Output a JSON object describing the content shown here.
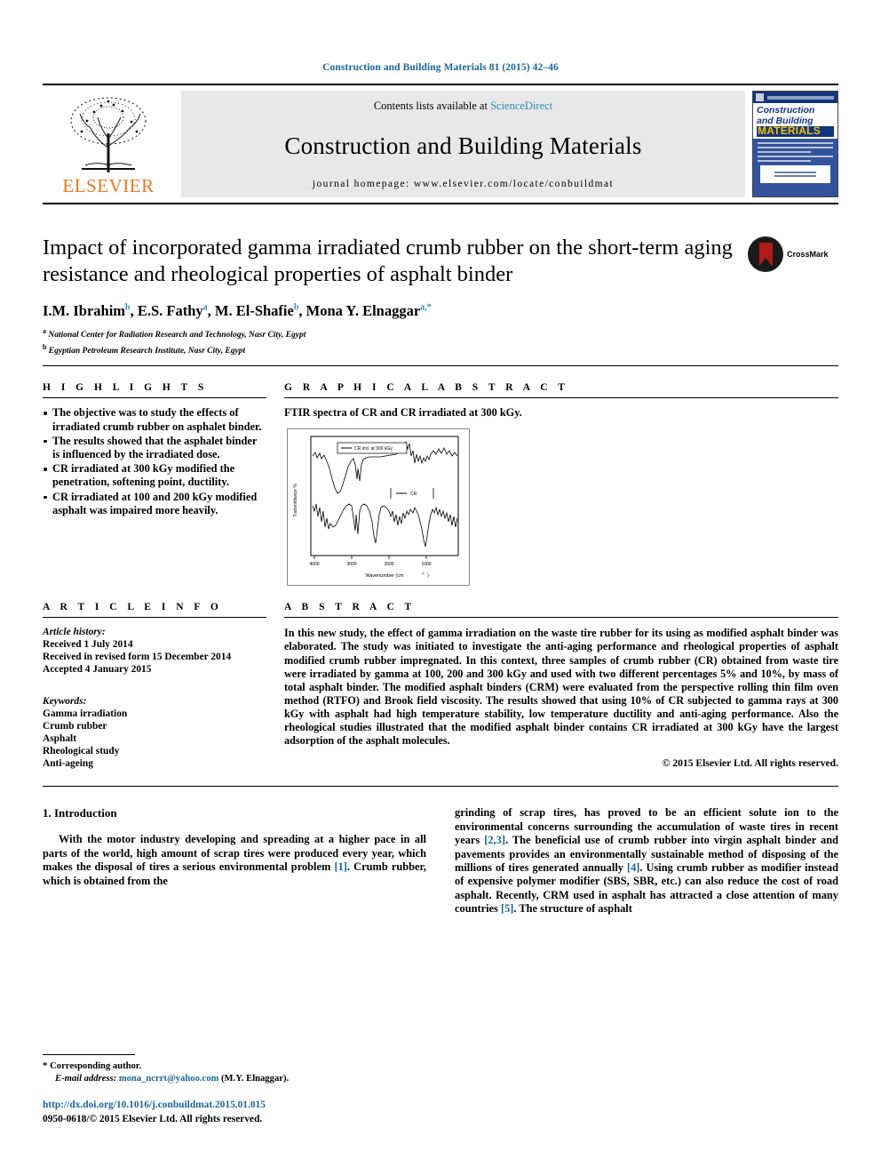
{
  "running_head": "Construction and Building Materials 81 (2015) 42–46",
  "masthead": {
    "publisher": "ELSEVIER",
    "contents_prefix": "Contents lists available at ",
    "contents_link": "ScienceDirect",
    "journal_name": "Construction and Building Materials",
    "homepage": "journal homepage: www.elsevier.com/locate/conbuildmat",
    "cover": {
      "line1": "Construction",
      "line2": "and Building",
      "line3": "MATERIALS"
    }
  },
  "article": {
    "title": "Impact of incorporated gamma irradiated crumb rubber on the short-term aging resistance and rheological properties of asphalt binder",
    "crossmark_label": "CrossMark",
    "authors": [
      {
        "name": "I.M. Ibrahim",
        "sup": "b"
      },
      {
        "name": "E.S. Fathy",
        "sup": "a"
      },
      {
        "name": "M. El-Shafie",
        "sup": "b"
      },
      {
        "name": "Mona Y. Elnaggar",
        "sup": "a,*"
      }
    ],
    "affiliations": [
      {
        "mark": "a",
        "text": "National Center for Radiation Research and Technology, Nasr City, Egypt"
      },
      {
        "mark": "b",
        "text": "Egyptian Petroleum Research Institute, Nasr City, Egypt"
      }
    ]
  },
  "highlights": {
    "heading": "H I G H L I G H T S",
    "items": [
      "The objective was to study the effects of irradiated crumb rubber on asphalet binder.",
      "The results showed that the asphalet binder is influenced by the irradiated dose.",
      "CR irradiated at 300 kGy modified the penetration, softening point, ductility.",
      "CR irradiated at 100 and 200 kGy modified asphalt was impaired more heavily."
    ]
  },
  "graphical_abstract": {
    "heading": "G R A P H I C A L   A B S T R A C T",
    "caption": "FTIR spectra of CR and CR irradiated at 300 kGy."
  },
  "chart_data": {
    "type": "line",
    "title": "FTIR spectra of CR and CR irradiated at 300 kGy.",
    "xlabel": "Wavenumber (cm-1)",
    "ylabel": "Transmittance %",
    "xlim": [
      4000,
      500
    ],
    "xticks": [
      4000,
      3000,
      2000,
      1000
    ],
    "grid": false,
    "legend_position": "inside",
    "series": [
      {
        "name": "CR irrd. at 300 kGy",
        "offset": "upper",
        "peaks_cm1": [
          3700,
          3420,
          2920,
          2850,
          1640,
          1540,
          1450,
          1370,
          1100,
          870,
          720
        ]
      },
      {
        "name": "CR",
        "offset": "lower",
        "peaks_cm1": [
          3420,
          2920,
          2850,
          2350,
          1640,
          1540,
          1450,
          1370,
          1090,
          1010,
          870,
          720
        ]
      }
    ]
  },
  "article_info": {
    "heading": "A R T I C L E   I N F O",
    "history_label": "Article history:",
    "history": [
      "Received 1 July 2014",
      "Received in revised form 15 December 2014",
      "Accepted 4 January 2015"
    ],
    "keywords_label": "Keywords:",
    "keywords": [
      "Gamma irradiation",
      "Crumb rubber",
      "Asphalt",
      "Rheological study",
      "Anti-ageing"
    ]
  },
  "abstract": {
    "heading": "A B S T R A C T",
    "text": "In this new study, the effect of gamma irradiation on the waste tire rubber for its using as modified asphalt binder was elaborated. The study was initiated to investigate the anti-aging performance and rheological properties of asphalt modified crumb rubber impregnated. In this context, three samples of crumb rubber (CR) obtained from waste tire were irradiated by gamma at 100, 200 and 300 kGy and used with two different percentages 5% and 10%, by mass of total asphalt binder. The modified asphalt binders (CRM) were evaluated from the perspective rolling thin film oven method (RTFO) and Brook field viscosity. The results showed that using 10% of CR subjected to gamma rays at 300 kGy with asphalt had high temperature stability, low temperature ductility and anti-aging performance. Also the rheological studies illustrated that the modified asphalt binder contains CR irradiated at 300 kGy have the largest adsorption of the asphalt molecules.",
    "copyright": "© 2015 Elsevier Ltd. All rights reserved."
  },
  "body": {
    "section_heading": "1. Introduction",
    "left_paragraph_parts": [
      "With the motor industry developing and spreading at a higher pace in all parts of the world, high amount of scrap tires were produced every year, which makes the disposal of tires a serious environmental problem ",
      "[1]",
      ". Crumb rubber, which is obtained from the"
    ],
    "right_paragraph_parts": [
      "grinding of scrap tires, has proved to be an efficient solute ion to the environmental concerns surrounding the accumulation of waste tires in recent years ",
      "[2,3]",
      ". The beneficial use of crumb rubber into virgin asphalt binder and pavements provides an environmentally sustainable method of disposing of the millions of tires generated annually ",
      "[4]",
      ". Using crumb rubber as modifier instead of expensive polymer modifier (SBS, SBR, etc.) can also reduce the cost of road asphalt. Recently, CRM used in asphalt has attracted a close attention of many countries ",
      "[5]",
      ". The structure of asphalt"
    ]
  },
  "footer": {
    "corresponding_star": "*",
    "corresponding_text": "Corresponding author.",
    "email_label": "E-mail address:",
    "email": "mona_ncrrt@yahoo.com",
    "email_owner": "(M.Y. Elnaggar).",
    "doi": "http://dx.doi.org/10.1016/j.conbuildmat.2015.01.015",
    "issn_line": "0950-0618/© 2015 Elsevier Ltd. All rights reserved."
  }
}
